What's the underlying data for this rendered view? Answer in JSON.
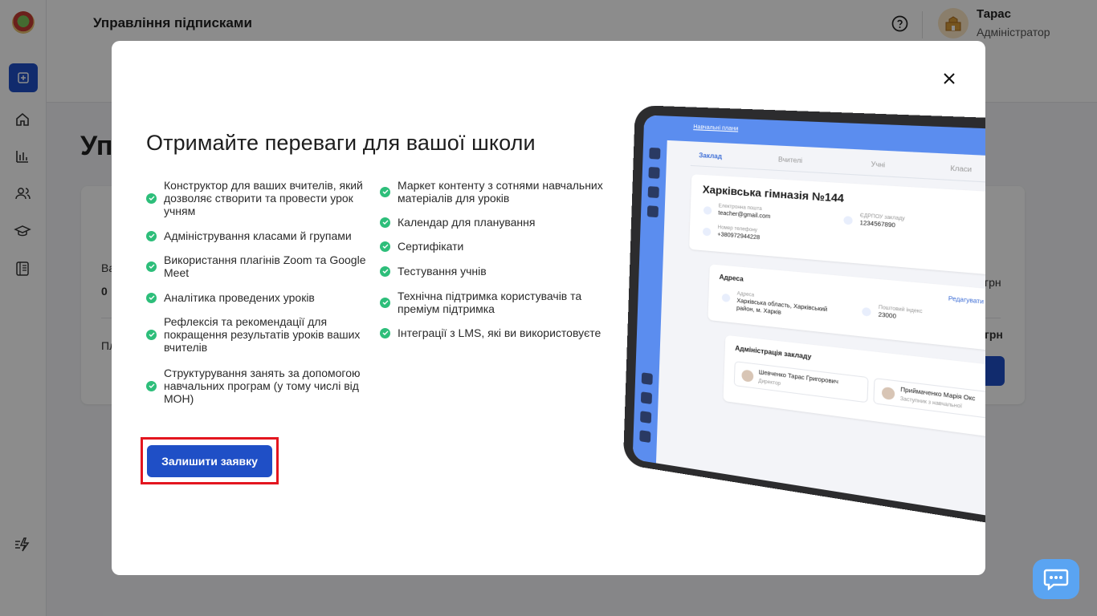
{
  "app": {
    "header_title": "Управління підписками",
    "page_heading": "Уп",
    "user": {
      "name": "Тарас",
      "role": "Адміністратор"
    },
    "background_fragments": {
      "left_1": "Ва",
      "left_2": "0",
      "left_3": "Пл",
      "right_1": "грн",
      "right_2": "грн"
    }
  },
  "sidebar": {
    "items": [
      {
        "name": "add-icon"
      },
      {
        "name": "home-icon"
      },
      {
        "name": "stats-icon"
      },
      {
        "name": "users-icon"
      },
      {
        "name": "graduation-icon"
      },
      {
        "name": "journal-icon"
      },
      {
        "name": "flash-icon"
      }
    ]
  },
  "modal": {
    "title": "Отримайте переваги для вашої школи",
    "benefits_left": [
      "Конструктор для ваших вчителів, який дозволяє створити та провести урок учням",
      "Адміністрування класами й групами",
      "Використання плагінів Zoom та Google Meet",
      "Аналітика проведених уроків",
      "Рефлексія та рекомендації для покращення результатів уроків ваших вчителів",
      "Структурування занять за допомогою навчальних програм (у тому числі від МОН)"
    ],
    "benefits_right": [
      "Маркет контенту з сотнями навчальних матеріалів для уроків",
      "Календар для планування",
      "Сертифікати",
      "Тестування учнів",
      "Технічна підтримка користувачів та преміум підтримка",
      "Інтеграції з LMS, які ви використовуєте"
    ],
    "cta_label": "Залишити заявку",
    "accent_color": "#1f4fc6",
    "check_color": "#2dbe7a",
    "highlight_color": "#e3161f"
  },
  "mockup": {
    "top_link": "Навчальні плани",
    "tabs": [
      "Заклад",
      "Вчителі",
      "Учні",
      "Класи"
    ],
    "school_name": "Харківська гімназія №144",
    "edit_label": "Редагувати",
    "email_label": "Електронна пошта",
    "email_value": "teacher@gmail.com",
    "edrpou_label": "ЄДРПОУ закладу",
    "edrpou_value": "1234567890",
    "phone_label": "Номер телефону",
    "phone_value": "+380972944228",
    "address_section": "Адреса",
    "address_label": "Адреса",
    "address_value_1": "Харківська область, Харківський",
    "address_value_2": "район, м. Харків",
    "postcode_label": "Поштовий індекс",
    "postcode_value": "23000",
    "admin_section": "Адміністрація закладу",
    "person1_name": "Шевченко Тарас Григорович",
    "person1_role": "Директор",
    "person2_name": "Приймаченко Марія Окс",
    "person2_role": "Заступник з навчальної"
  }
}
